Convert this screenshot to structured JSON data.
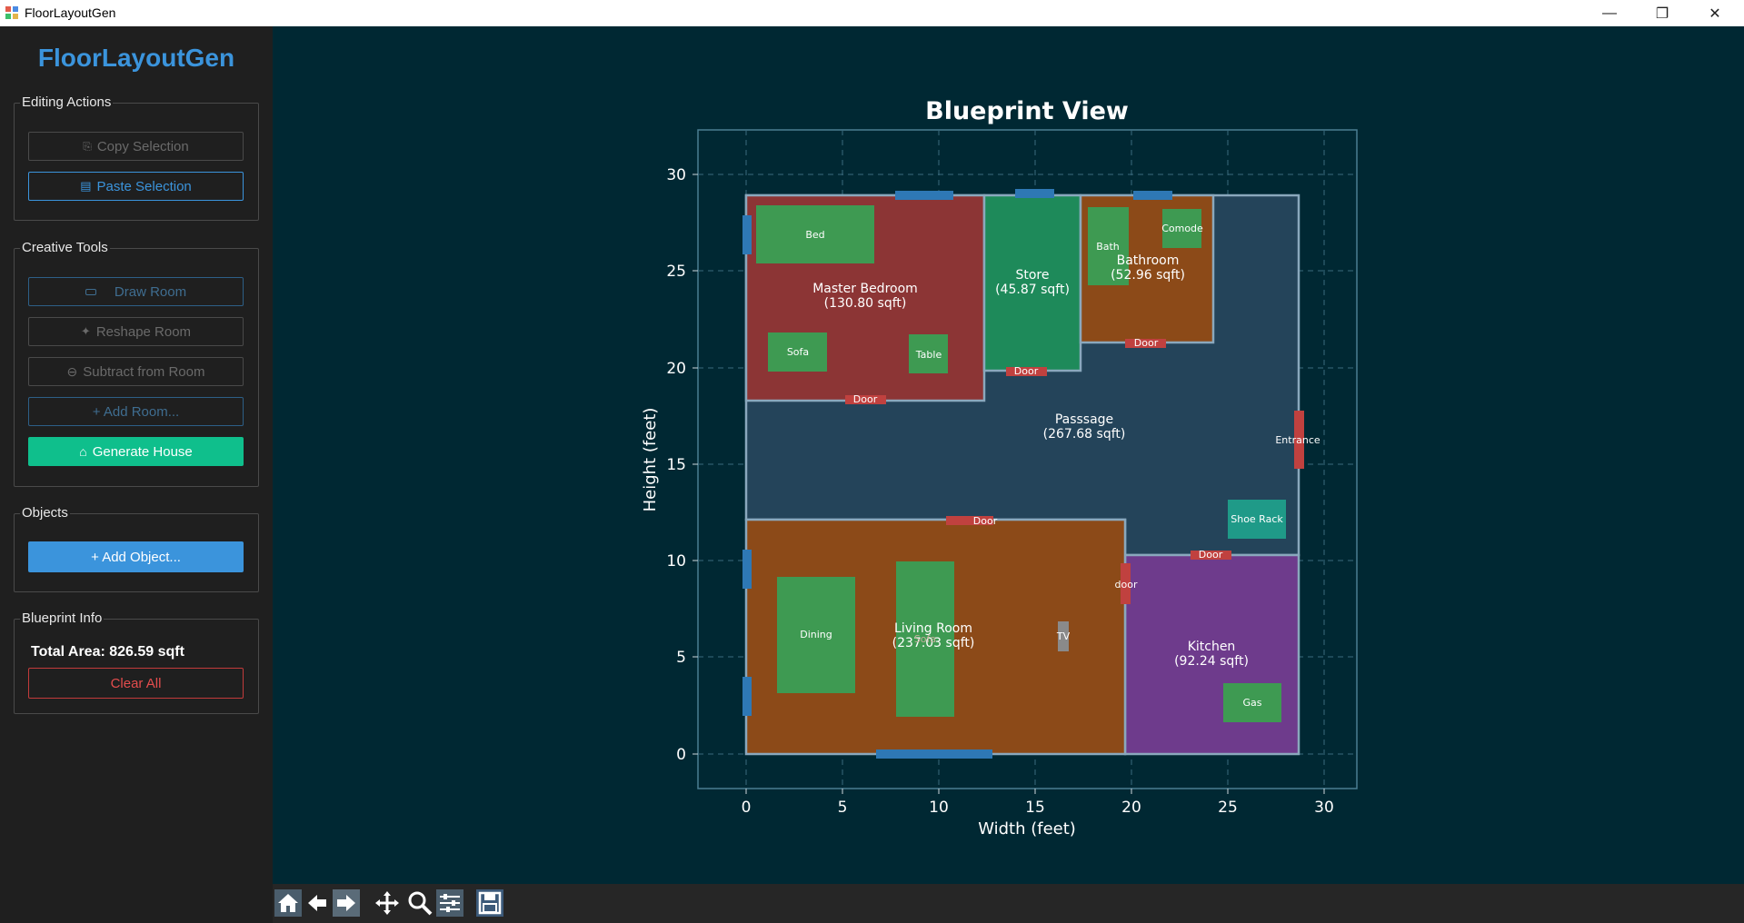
{
  "window": {
    "title": "FloorLayoutGen",
    "minimize": "—",
    "maximize": "❐",
    "close": "✕"
  },
  "sidebar": {
    "app_title": "FloorLayoutGen",
    "editing": {
      "title": "Editing Actions",
      "copy": "Copy Selection",
      "paste": "Paste Selection"
    },
    "creative": {
      "title": "Creative Tools",
      "draw": "Draw Room",
      "reshape": "Reshape Room",
      "subtract": "Subtract from Room",
      "add_room": "+ Add Room...",
      "generate": "Generate House"
    },
    "objects": {
      "title": "Objects",
      "add_object": "+ Add Object..."
    },
    "info": {
      "title": "Blueprint Info",
      "total_area": "Total Area: 826.59 sqft",
      "clear": "Clear All"
    }
  },
  "chart": {
    "title": "Blueprint View",
    "xlabel": "Width (feet)",
    "ylabel": "Height (feet)",
    "xticks": [
      "0",
      "5",
      "10",
      "15",
      "20",
      "25",
      "30"
    ],
    "yticks": [
      "0",
      "5",
      "10",
      "15",
      "20",
      "25",
      "30"
    ],
    "rooms": [
      {
        "name": "Master Bedroom",
        "area": "(130.80 sqft)"
      },
      {
        "name": "Store",
        "area": "(45.87 sqft)"
      },
      {
        "name": "Bathroom",
        "area": "(52.96 sqft)"
      },
      {
        "name": "Passsage",
        "area": "(267.68 sqft)"
      },
      {
        "name": "Living Room",
        "area": "(237.03 sqft)"
      },
      {
        "name": "Kitchen",
        "area": "(92.24 sqft)"
      }
    ],
    "objects": [
      "Bed",
      "Sofa",
      "Table",
      "Bath",
      "Comode",
      "Shoe Rack",
      "Dining",
      "Sofa",
      "TV",
      "Gas"
    ],
    "doors": [
      "Door",
      "Door",
      "Door",
      "Door",
      "Door",
      "door",
      "Entrance"
    ]
  },
  "chart_data": {
    "type": "floorplan",
    "title": "Blueprint View",
    "xlabel": "Width (feet)",
    "ylabel": "Height (feet)",
    "xlim": [
      -2.5,
      31.5
    ],
    "ylim": [
      -1.8,
      32.3
    ],
    "grid": true,
    "rooms": [
      {
        "name": "Master Bedroom",
        "area_sqft": 130.8,
        "x": [
          0,
          12.5
        ],
        "y": [
          18.2,
          28.9
        ],
        "color": "#8c3535"
      },
      {
        "name": "Store",
        "area_sqft": 45.87,
        "x": [
          12.5,
          17.5
        ],
        "y": [
          19.8,
          28.9
        ],
        "color": "#1e8a5a"
      },
      {
        "name": "Bathroom",
        "area_sqft": 52.96,
        "x": [
          17.5,
          24.3
        ],
        "y": [
          21.2,
          28.9
        ],
        "color": "#8c4a18"
      },
      {
        "name": "Passsage",
        "area_sqft": 267.68,
        "x": [
          0,
          28.6
        ],
        "y": [
          10.3,
          28.9
        ],
        "color": "#24445a"
      },
      {
        "name": "Living Room",
        "area_sqft": 237.03,
        "x": [
          0,
          19.6
        ],
        "y": [
          0,
          12.1
        ],
        "color": "#8c4a18"
      },
      {
        "name": "Kitchen",
        "area_sqft": 92.24,
        "x": [
          19.6,
          28.6
        ],
        "y": [
          0,
          10.3
        ],
        "color": "#6e3b8c"
      }
    ]
  },
  "toolbar": {
    "home": "home-icon",
    "back": "back-icon",
    "forward": "forward-icon",
    "pan": "pan-icon",
    "zoom": "zoom-icon",
    "configure": "configure-icon",
    "save": "save-icon"
  },
  "colors": {
    "accent": "#3b94dc",
    "generate": "#0fbf8c",
    "danger": "#c23b3b",
    "canvas": "#002833",
    "sidebar": "#1f1f1f"
  }
}
